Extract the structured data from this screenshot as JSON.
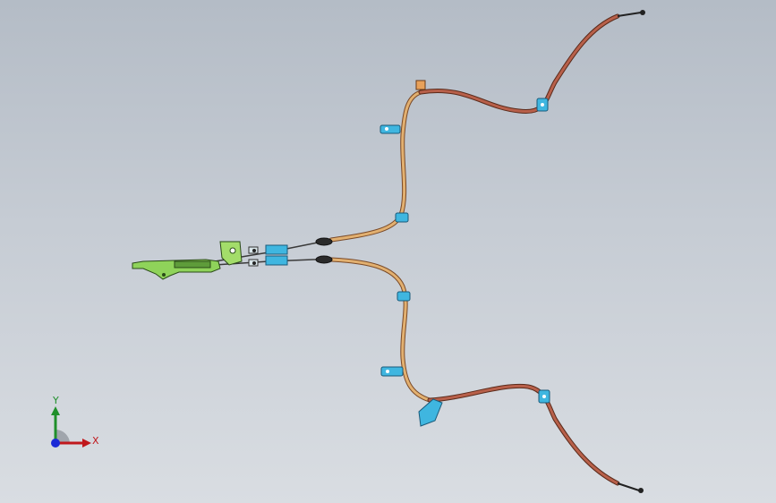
{
  "viewport": {
    "background_top": "#b4bcc6",
    "background_bottom": "#d9dde2"
  },
  "triad": {
    "y_label": "Y",
    "x_label": "X",
    "y_color": "#1f8f2a",
    "x_color": "#c0181c",
    "z_color": "#1a2ad6"
  },
  "colors": {
    "cable_jacket": "#9a4a32",
    "cable_conduit": "#e2b070",
    "clip": "#3fb6e0",
    "lever": "#8fd35a",
    "terminal": "#222222",
    "bracket": "#e8a15a"
  }
}
